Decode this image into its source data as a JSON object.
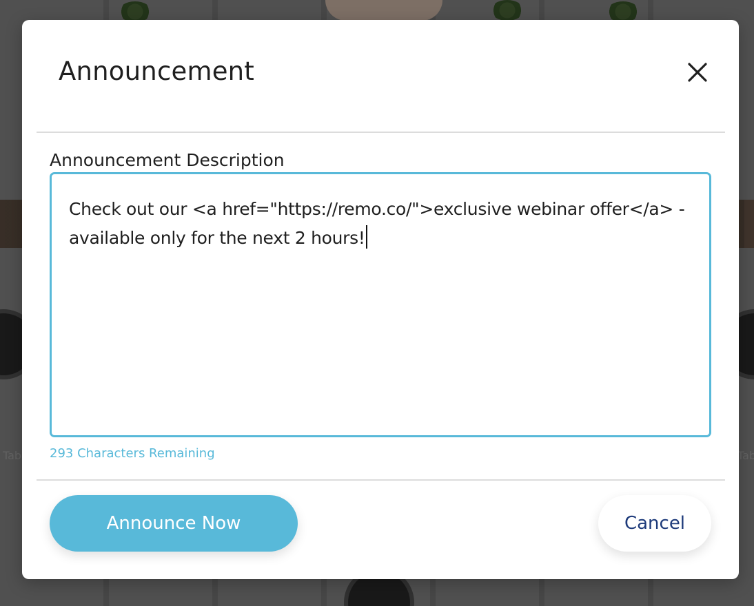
{
  "background": {
    "left_label": "Tab",
    "right_label": "Tab"
  },
  "modal": {
    "title": "Announcement",
    "close_icon": "close-icon",
    "description_label": "Announcement Description",
    "description_value": "Check out our <a href=\"https://remo.co/\">exclusive webinar offer</a> - available only for the next 2 hours!",
    "characters_remaining": "293 Characters Remaining",
    "announce_button_label": "Announce Now",
    "cancel_button_label": "Cancel"
  },
  "colors": {
    "accent": "#58b9d9",
    "cancel_text": "#1d3a7a",
    "title_text": "#1f1f1f"
  }
}
